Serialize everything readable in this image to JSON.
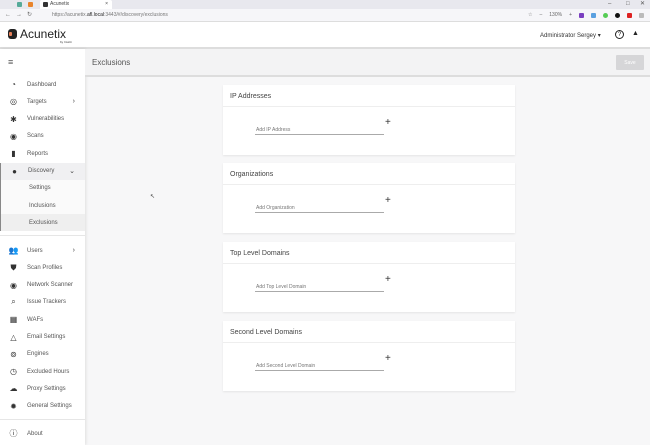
{
  "browser": {
    "tab_title": "Acunetix",
    "tab_close": "×",
    "url_prefix": "https://acunetix.",
    "url_domain": "afl.local",
    "url_rest": ":3443/#/discovery/exclusions",
    "zoom": "130%",
    "zoom_minus": "–",
    "zoom_plus": "+",
    "back": "←",
    "forward": "→",
    "reload": "↻",
    "bookmark": "☆",
    "minimize": "–",
    "maximize": "□",
    "close": "✕"
  },
  "app": {
    "logo_text": "Acunetix",
    "logo_sub": "by Invicti",
    "user": "Administrator Sergey ▾",
    "help_icon": "?",
    "bell_icon": "🔔"
  },
  "sidebar": {
    "items": [
      {
        "label": "Dashboard",
        "icon": "◔"
      },
      {
        "label": "Targets",
        "icon": "◎",
        "chevron": "›"
      },
      {
        "label": "Vulnerabilities",
        "icon": "✱"
      },
      {
        "label": "Scans",
        "icon": "◉"
      },
      {
        "label": "Reports",
        "icon": "▮"
      },
      {
        "label": "Discovery",
        "icon": "●",
        "chevron": "⌄"
      }
    ],
    "discovery_sub": [
      "Settings",
      "Inclusions",
      "Exclusions"
    ],
    "items2": [
      {
        "label": "Users",
        "icon": "👥",
        "chevron": "›"
      },
      {
        "label": "Scan Profiles",
        "icon": "⛊"
      },
      {
        "label": "Network Scanner",
        "icon": "◉"
      },
      {
        "label": "Issue Trackers",
        "icon": "⌕"
      },
      {
        "label": "WAFs",
        "icon": "▦"
      },
      {
        "label": "Email Settings",
        "icon": "△"
      },
      {
        "label": "Engines",
        "icon": "⊚"
      },
      {
        "label": "Excluded Hours",
        "icon": "◷"
      },
      {
        "label": "Proxy Settings",
        "icon": "☁"
      },
      {
        "label": "General Settings",
        "icon": "✹"
      }
    ],
    "about": {
      "label": "About",
      "icon": "ⓘ"
    }
  },
  "page": {
    "title": "Exclusions",
    "save": "Save"
  },
  "cards": [
    {
      "title": "IP Addresses",
      "placeholder": "Add IP Address"
    },
    {
      "title": "Organizations",
      "placeholder": "Add Organization"
    },
    {
      "title": "Top Level Domains",
      "placeholder": "Add Top Level Domain"
    },
    {
      "title": "Second Level Domains",
      "placeholder": "Add Second Level Domain"
    }
  ],
  "plus": "+"
}
